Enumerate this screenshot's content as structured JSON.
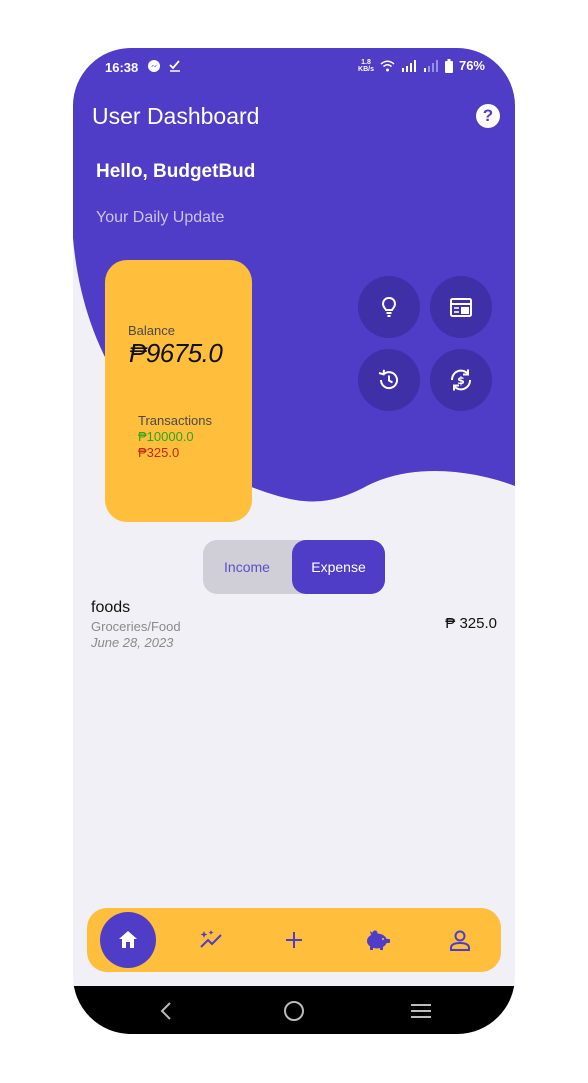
{
  "status_bar": {
    "time": "16:38",
    "net_speed_value": "1.8",
    "net_speed_unit": "KB/s",
    "battery": "76%"
  },
  "header": {
    "title": "User Dashboard",
    "help_label": "?"
  },
  "greeting": "Hello, BudgetBud",
  "subtitle": "Your Daily Update",
  "balance_card": {
    "balance_label": "Balance",
    "balance_value": "₱9675.0",
    "transactions_label": "Transactions",
    "income_value": "₱10000.0",
    "expense_value": "₱325.0"
  },
  "quick_actions": [
    {
      "icon": "lightbulb-icon"
    },
    {
      "icon": "calendar-icon"
    },
    {
      "icon": "history-icon"
    },
    {
      "icon": "currency-exchange-icon"
    }
  ],
  "toggle": {
    "income_label": "Income",
    "expense_label": "Expense",
    "selected": "Expense"
  },
  "transactions": [
    {
      "title": "foods",
      "category": "Groceries/Food",
      "date": "June 28, 2023",
      "amount": "₱ 325.0"
    }
  ],
  "bottom_nav": [
    {
      "icon": "home-icon",
      "active": true
    },
    {
      "icon": "sparkle-chart-icon",
      "active": false
    },
    {
      "icon": "plus-icon",
      "active": false
    },
    {
      "icon": "piggy-bank-icon",
      "active": false
    },
    {
      "icon": "user-icon",
      "active": false
    }
  ],
  "colors": {
    "primary": "#4F3CC7",
    "accent": "#FFBE3B",
    "background": "#F1F0F7",
    "income": "#2EA51E",
    "expense": "#C4270F"
  }
}
